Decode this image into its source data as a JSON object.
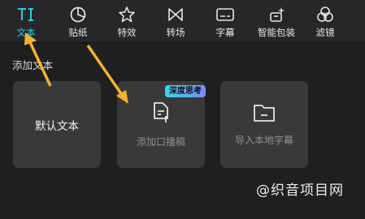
{
  "toolbar": {
    "tabs": [
      {
        "label": "文本",
        "icon": "text-tool-icon",
        "active": true
      },
      {
        "label": "贴纸",
        "icon": "sticker-icon"
      },
      {
        "label": "特效",
        "icon": "effects-star-icon"
      },
      {
        "label": "转场",
        "icon": "transition-icon"
      },
      {
        "label": "字幕",
        "icon": "subtitle-icon"
      },
      {
        "label": "智能包装",
        "icon": "smart-package-icon"
      },
      {
        "label": "滤镜",
        "icon": "filter-icon"
      }
    ]
  },
  "section": {
    "title": "添加文本"
  },
  "cards": {
    "default_text": {
      "label": "默认文本"
    },
    "add_script": {
      "label": "添加口播稿",
      "badge": "深度思考"
    },
    "import_subtitle": {
      "label": "导入本地字幕"
    }
  },
  "watermark": "@织音项目网",
  "colors": {
    "accent": "#24d3dc",
    "arrow": "#f4b32a"
  }
}
